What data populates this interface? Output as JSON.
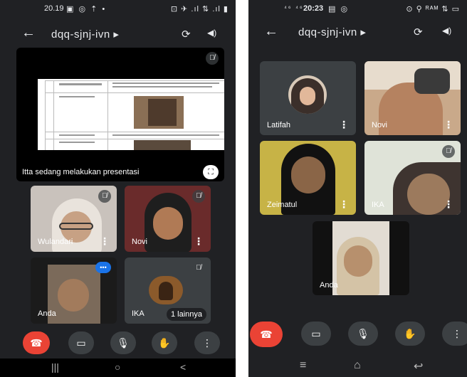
{
  "phone1": {
    "status": {
      "time": "20.19",
      "left_icons": "▣ ◎ ⇡ •",
      "right_icons": "⊡ ✈ .ıl ⇅ .ıl ▮"
    },
    "header": {
      "back": "←",
      "title": "dqq-sjnj-ivn ▸",
      "camera_switch": "⟳",
      "audio": "◀)"
    },
    "presentation": {
      "caption": "Itta sedang melakukan presentasi",
      "fullscreen": "⛶"
    },
    "tiles": [
      {
        "name": "Wulandari",
        "more": "⋮",
        "muted": true
      },
      {
        "name": "Novi",
        "more": "⋮",
        "muted": true
      },
      {
        "name": "Anda",
        "more": "•••",
        "muted": false
      },
      {
        "name": "IKA",
        "more": "",
        "muted": true
      }
    ],
    "others_chip": "1 lainnya",
    "controls": {
      "end": "☎",
      "video": "▭",
      "mic": "🎙",
      "hand": "✋",
      "more": "⋮"
    },
    "nav": {
      "recent": "|||",
      "home": "○",
      "back": "<"
    }
  },
  "phone2": {
    "status": {
      "time": "20:23",
      "left_icons": "⁴⁶ ⁴⁶",
      "after_time": "▤ ◎",
      "right_icons": "⊙ ⚲ ᴿᴬᴹ ⇅ ▭"
    },
    "header": {
      "back": "←",
      "title": "dqq-sjnj-ivn ▸",
      "camera_switch": "⟳",
      "audio": "◀)"
    },
    "tiles": [
      {
        "name": "Latifah",
        "more": "⋮",
        "muted": false
      },
      {
        "name": "Novi",
        "more": "⋮",
        "muted": false
      },
      {
        "name": "Zeimatul",
        "more": "⋮",
        "muted": false
      },
      {
        "name": "IKA",
        "more": "⋮",
        "muted": true
      },
      {
        "name": "Anda",
        "more": "",
        "muted": false
      }
    ],
    "controls": {
      "end": "☎",
      "video": "▭",
      "mic": "🎙",
      "hand": "✋",
      "more": "⋮"
    },
    "nav": {
      "menu": "≡",
      "home": "⌂",
      "back": "↩"
    }
  },
  "colors": {
    "background": "#202124",
    "tile": "#3c4043",
    "end_call": "#ea4335",
    "accent_blue": "#1a73e8"
  }
}
